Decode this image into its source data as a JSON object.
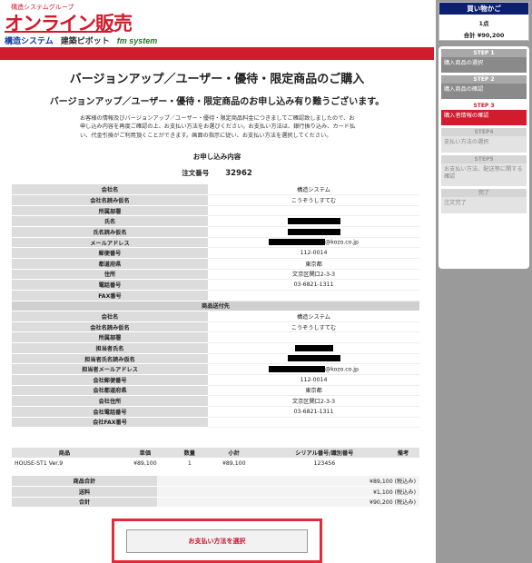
{
  "header": {
    "group_label": "構造システムグループ",
    "logo_main": "オンライン販売",
    "brand_1": "構造システム",
    "brand_2": "建築ピボット",
    "brand_3": "fm system"
  },
  "page": {
    "title": "バージョンアップ／ユーザー・優待・限定商品のご購入",
    "subtitle": "バージョンアップ／ユーザー・優待・限定商品のお申し込み有り難うございます。",
    "intro": "お客様の情報及びバージョンアップ／ユーザー・優待・限定商品料金につきましてご確認致しましたので、お申し込み内容を再度ご確認の上、お支払い方法をお選びください。お支払い方法は、銀行振り込み、カード払い、代金引換がご利用頂くことができます。画面の指示に従い、お支払い方法を選択してください。",
    "section_heading": "お申し込み内容",
    "order_label": "注文番号",
    "order_number": "32962"
  },
  "customer": {
    "rows": [
      {
        "label": "会社名",
        "value": "構造システム"
      },
      {
        "label": "会社名読み仮名",
        "value": "こうぞうしすてむ"
      },
      {
        "label": "所属部署",
        "value": ""
      },
      {
        "label": "氏名",
        "value": ""
      },
      {
        "label": "氏名読み仮名",
        "value": ""
      },
      {
        "label": "メールアドレス",
        "value": "@kozo.co.jp"
      },
      {
        "label": "郵便番号",
        "value": "112-0014"
      },
      {
        "label": "都道府県",
        "value": "東京都"
      },
      {
        "label": "住所",
        "value": "文京区関口2-3-3"
      },
      {
        "label": "電話番号",
        "value": "03-6821-1311"
      },
      {
        "label": "FAX番号",
        "value": ""
      }
    ]
  },
  "shipping": {
    "heading": "商品送付先",
    "rows": [
      {
        "label": "会社名",
        "value": "構造システム"
      },
      {
        "label": "会社名読み仮名",
        "value": "こうぞうしすてむ"
      },
      {
        "label": "所属部署",
        "value": ""
      },
      {
        "label": "担当者氏名",
        "value": ""
      },
      {
        "label": "担当者氏名読み仮名",
        "value": ""
      },
      {
        "label": "担当者メールアドレス",
        "value": "@kozo.co.jp"
      },
      {
        "label": "会社郵便番号",
        "value": "112-0014"
      },
      {
        "label": "会社都道府県",
        "value": "東京都"
      },
      {
        "label": "会社住所",
        "value": "文京区関口2-3-3"
      },
      {
        "label": "会社電話番号",
        "value": "03-6821-1311"
      },
      {
        "label": "会社FAX番号",
        "value": ""
      }
    ]
  },
  "products": {
    "headers": [
      "商品",
      "単価",
      "数量",
      "小計",
      "シリアル番号/識別番号",
      "備考"
    ],
    "rows": [
      {
        "name": "HOUSE-ST1 Ver.9",
        "price": "¥89,100",
        "qty": "1",
        "subtotal": "¥89,100",
        "serial": "123456",
        "note": ""
      }
    ]
  },
  "summary": {
    "rows": [
      {
        "label": "商品合計",
        "value": "¥89,100 (税込み)"
      },
      {
        "label": "送料",
        "value": "¥1,100 (税込み)"
      },
      {
        "label": "合計",
        "value": "¥90,200 (税込み)"
      }
    ]
  },
  "action": {
    "pay_button_label": "お支払い方法を選択"
  },
  "sidebar": {
    "cart_title": "買い物かご",
    "cart_count": "1点",
    "cart_total": "合計 ¥90,200",
    "steps": [
      {
        "num": "STEP 1",
        "label": "購入商品の選択",
        "state": "done"
      },
      {
        "num": "STEP 2",
        "label": "購入商品の確認",
        "state": "done"
      },
      {
        "num": "STEP 3",
        "label": "購入者情報の確認",
        "state": "current"
      },
      {
        "num": "STEP4",
        "label": "支払い方法の選択",
        "state": "todo"
      },
      {
        "num": "STEP5",
        "label": "お支払い方法、配送等に関する確認",
        "state": "todo"
      },
      {
        "num": "完了",
        "label": "注文完了",
        "state": "todo"
      }
    ]
  },
  "colors": {
    "brand_red": "#d01c2c",
    "navy": "#0c1f70",
    "sidebar_gray": "#9a9a9a"
  }
}
